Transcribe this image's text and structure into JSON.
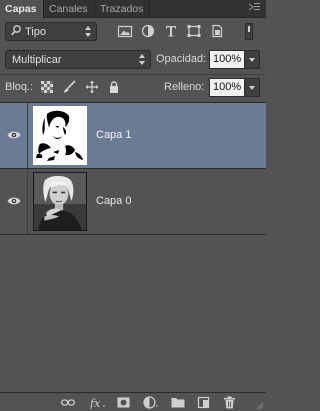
{
  "tabs": [
    {
      "label": "Capas",
      "active": true
    },
    {
      "label": "Canales",
      "active": false
    },
    {
      "label": "Trazados",
      "active": false
    }
  ],
  "filter": {
    "kind_label": "Tipo",
    "icons": [
      "image-filter-icon",
      "adjustment-filter-icon",
      "type-filter-icon",
      "shape-filter-icon",
      "smart-object-filter-icon"
    ]
  },
  "blend": {
    "mode": "Multiplicar",
    "opacity_label": "Opacidad:",
    "opacity_value": "100%"
  },
  "lock": {
    "label": "Bloq.:",
    "icons": [
      "lock-transparent-pixels-icon",
      "lock-image-pixels-icon",
      "lock-position-icon",
      "lock-all-icon"
    ],
    "fill_label": "Relleno:",
    "fill_value": "100%"
  },
  "layers": [
    {
      "name": "Capa 1",
      "visible": true,
      "selected": true
    },
    {
      "name": "Capa 0",
      "visible": true,
      "selected": false
    }
  ],
  "bottom_toolbar": [
    "link-layers-icon",
    "layer-style-icon",
    "add-mask-icon",
    "adjustment-layer-icon",
    "new-group-icon",
    "new-layer-icon",
    "delete-layer-icon"
  ],
  "colors": {
    "panel": "#535353",
    "selection": "#6b7b94",
    "tabbar": "#323232"
  }
}
